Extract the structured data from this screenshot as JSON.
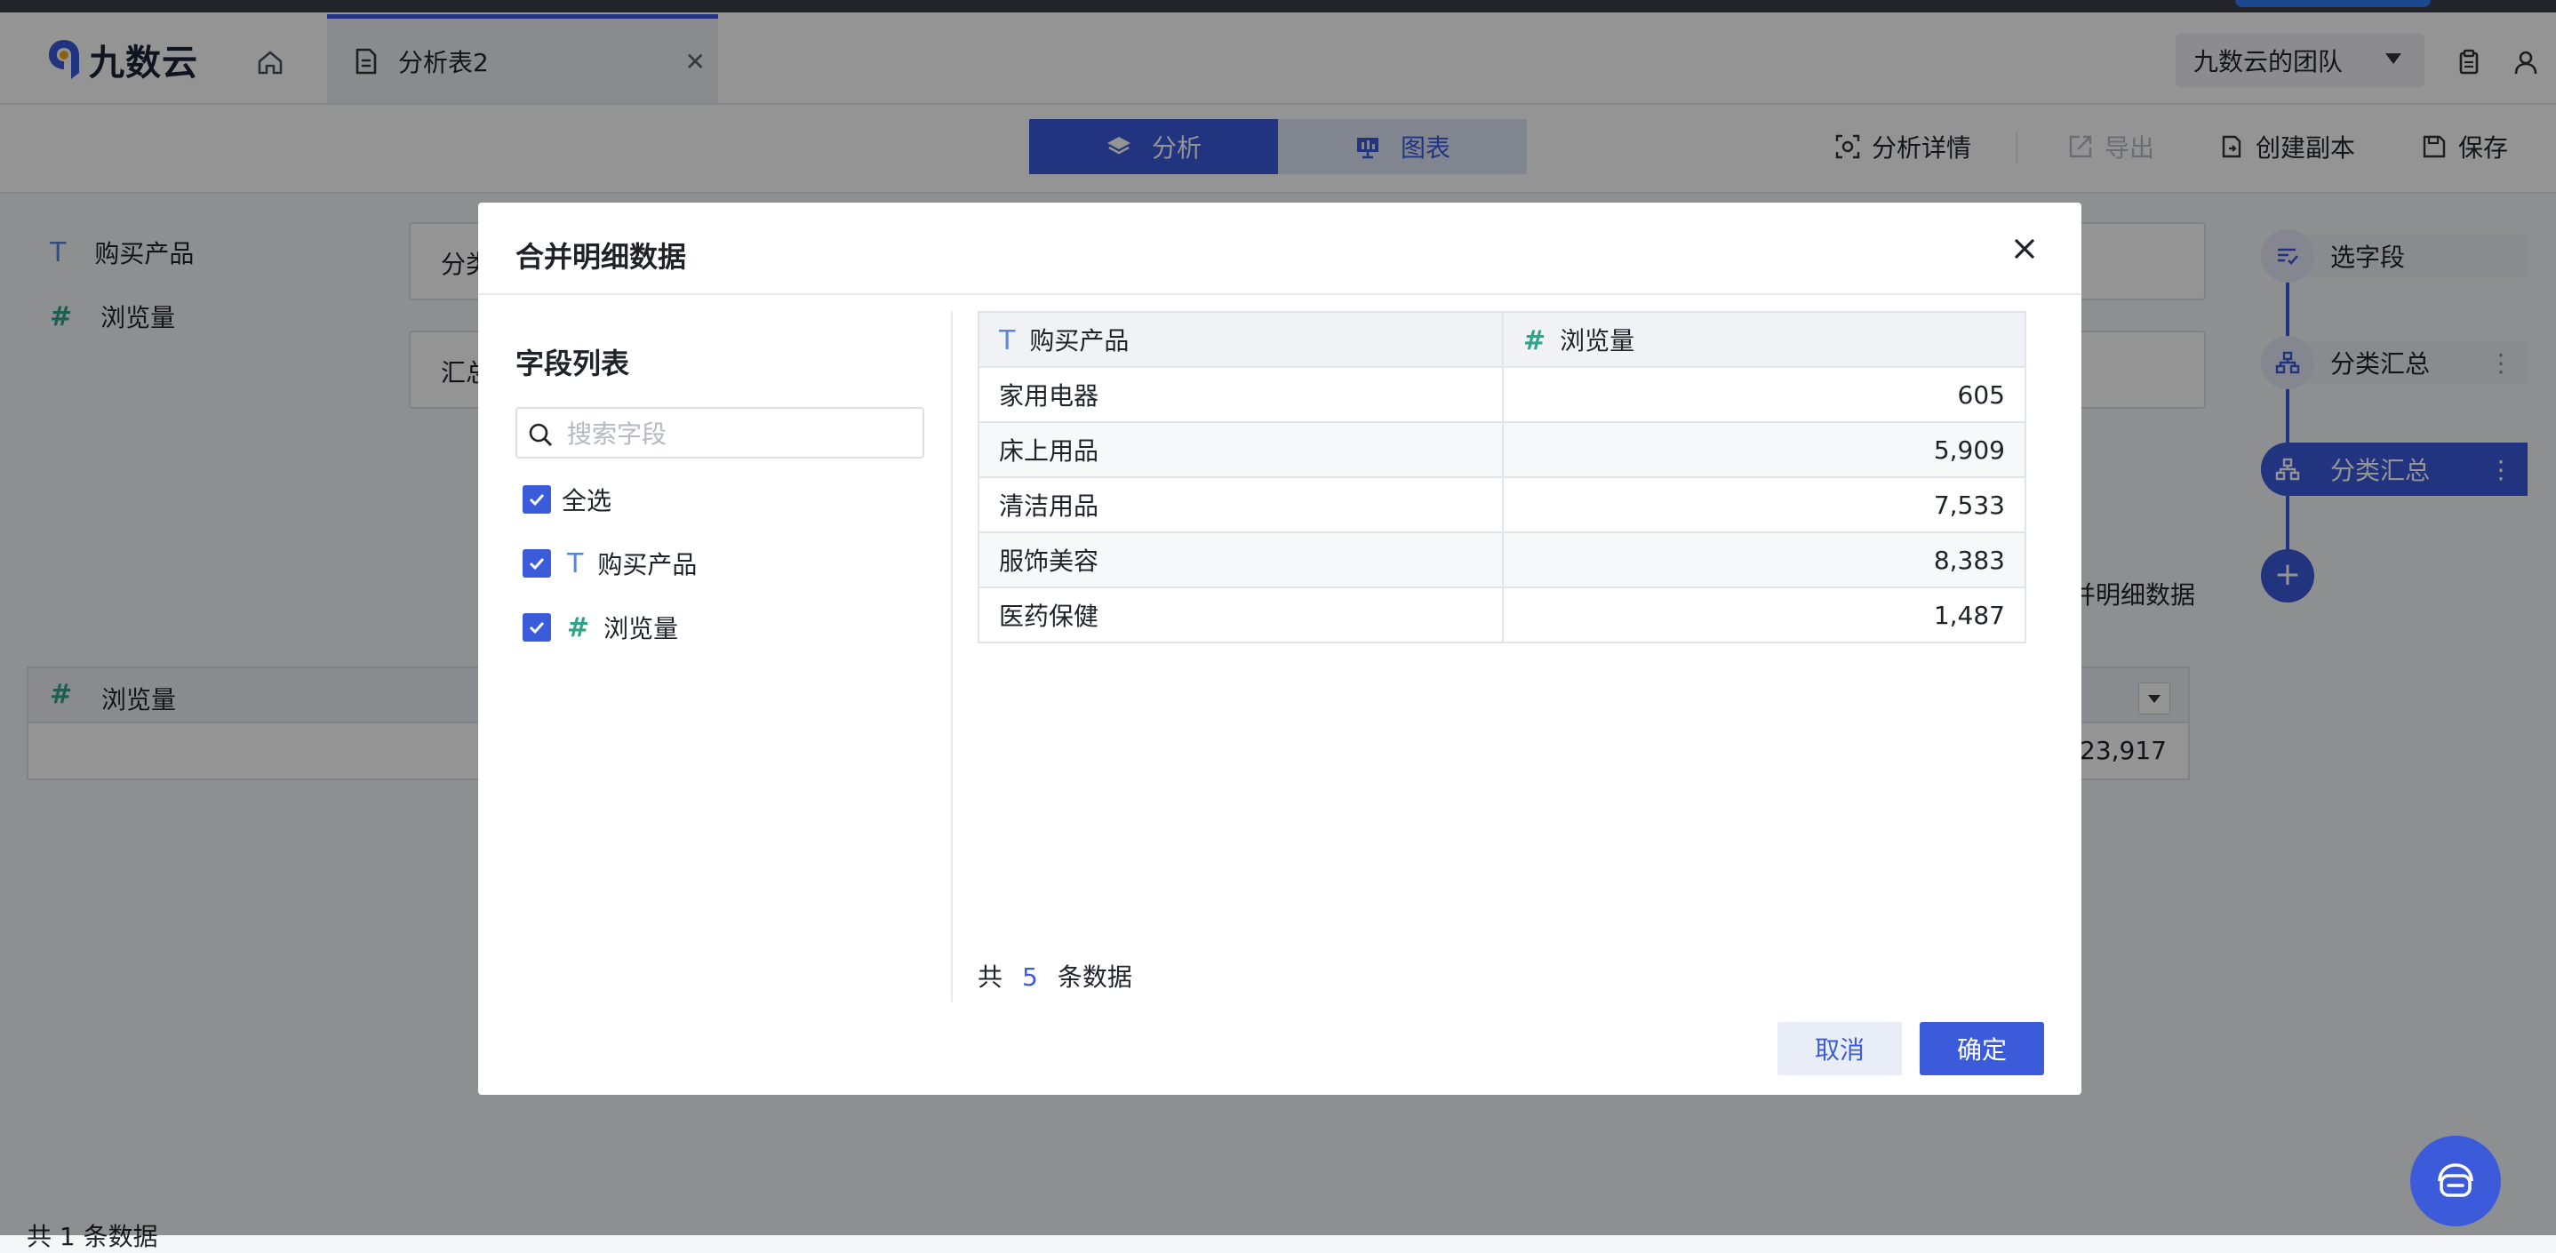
{
  "app": {
    "name": "九数云"
  },
  "tabs": [
    {
      "label": "分析表2"
    }
  ],
  "header": {
    "team": "九数云的团队"
  },
  "toolbar": {
    "seg_analysis": "分析",
    "seg_chart": "图表",
    "detail": "分析详情",
    "export": "导出",
    "copy": "创建副本",
    "save": "保存"
  },
  "workspace": {
    "fields": [
      {
        "type": "T",
        "label": "购买产品"
      },
      {
        "type": "#",
        "label": "浏览量"
      }
    ],
    "group_row_label": "分类",
    "summary_row_label": "汇总",
    "merge_detail_label": "并明细数据",
    "table": {
      "column": "浏览量",
      "total": "23,917"
    },
    "bottom_count": "共 1 条数据"
  },
  "flow": {
    "steps": [
      {
        "label": "选字段"
      },
      {
        "label": "分类汇总"
      },
      {
        "label": "分类汇总"
      }
    ]
  },
  "modal": {
    "title": "合并明细数据",
    "field_list_title": "字段列表",
    "search_placeholder": "搜索字段",
    "select_all": "全选",
    "fields": [
      {
        "type": "T",
        "label": "购买产品",
        "checked": true
      },
      {
        "type": "#",
        "label": "浏览量",
        "checked": true
      }
    ],
    "columns": [
      {
        "type": "T",
        "label": "购买产品"
      },
      {
        "type": "#",
        "label": "浏览量"
      }
    ],
    "rows": [
      [
        "家用电器",
        "605"
      ],
      [
        "床上用品",
        "5,909"
      ],
      [
        "清洁用品",
        "7,533"
      ],
      [
        "服饰美容",
        "8,383"
      ],
      [
        "医药保健",
        "1,487"
      ]
    ],
    "total_prefix": "共",
    "total_count": "5",
    "total_suffix": "条数据",
    "cancel": "取消",
    "confirm": "确定"
  },
  "colors": {
    "accent": "#3b5bdb",
    "field_text": "#5a84d6",
    "field_number": "#2fa48a"
  }
}
